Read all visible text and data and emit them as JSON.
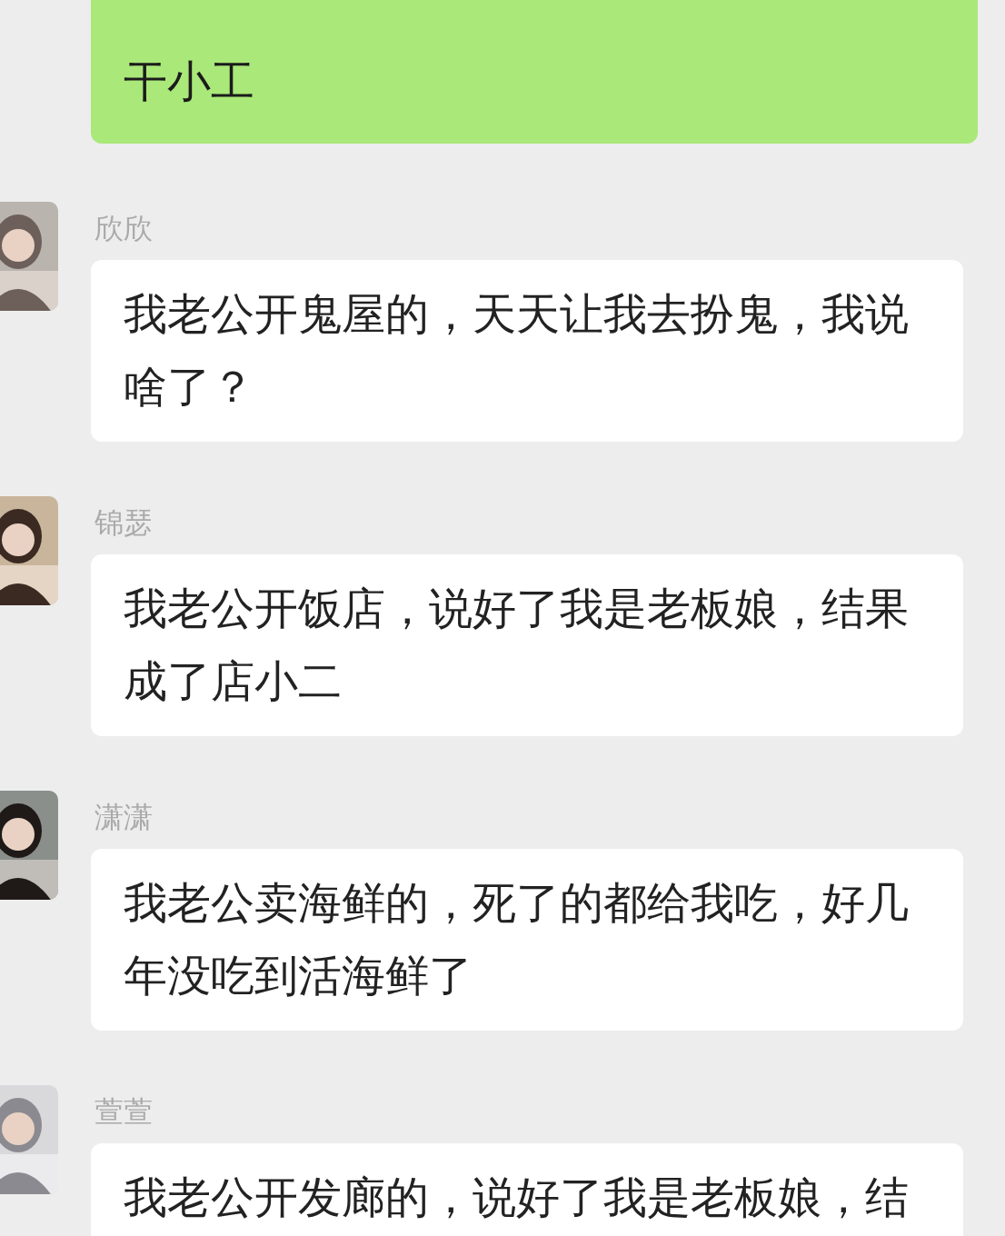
{
  "messages": [
    {
      "kind": "self",
      "text": "干小工"
    },
    {
      "kind": "other",
      "name": "欣欣",
      "text": "我老公开鬼屋的，天天让我去扮鬼，我说啥了？"
    },
    {
      "kind": "other",
      "name": "锦瑟",
      "text": "我老公开饭店，说好了我是老板娘，结果成了店小二"
    },
    {
      "kind": "other",
      "name": "潇潇",
      "text": "我老公卖海鲜的，死了的都给我吃，好几年没吃到活海鲜了"
    },
    {
      "kind": "other",
      "name": "萱萱",
      "text": "我老公开发廊的，说好了我是老板娘，结"
    }
  ]
}
